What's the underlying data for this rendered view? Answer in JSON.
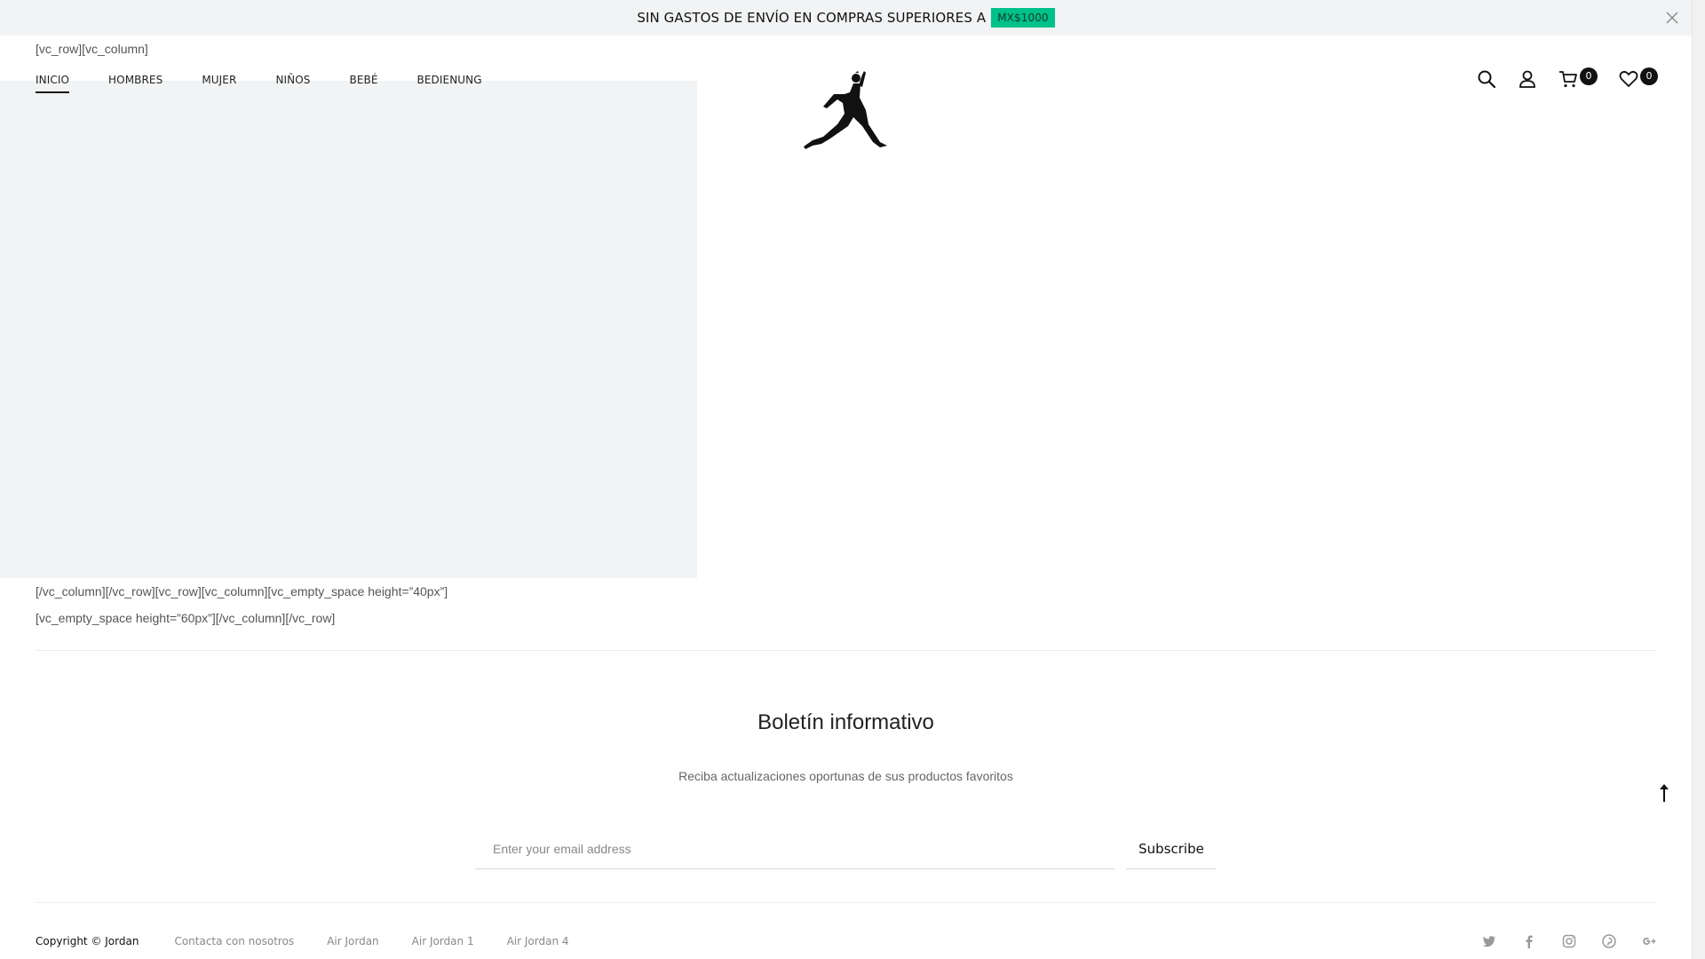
{
  "promo": {
    "text": "SIN GASTOS DE ENVÍO EN COMPRAS SUPERIORES A",
    "badge": "MX$1000",
    "badge_color": "#00c18a"
  },
  "shortcodes": {
    "top": "[vc_row][vc_column]",
    "line1": "[/vc_column][/vc_row][vc_row][vc_column][vc_empty_space height=”40px”]",
    "line2": "[vc_empty_space height=”60px”][/vc_column][/vc_row]"
  },
  "nav": {
    "items": [
      {
        "label": "INICIO"
      },
      {
        "label": "HOMBRES"
      },
      {
        "label": "MUJER"
      },
      {
        "label": "NIÑOS"
      },
      {
        "label": "BEBÉ"
      },
      {
        "label": "BEDIENUNG"
      }
    ]
  },
  "header": {
    "cart_count": "0",
    "wishlist_count": "0"
  },
  "newsletter": {
    "title": "Boletín informativo",
    "subtitle": "Reciba actualizaciones oportunas de sus productos favoritos",
    "placeholder": "Enter your email address",
    "button": "Subscribe"
  },
  "footer": {
    "copyright": "Copyright © Jordan",
    "links": [
      {
        "label": "Contacta con nosotros"
      },
      {
        "label": "Air Jordan"
      },
      {
        "label": "Air Jordan 1"
      },
      {
        "label": "Air Jordan 4"
      }
    ],
    "social_icons": [
      "twitter-icon",
      "facebook-icon",
      "instagram-icon",
      "pinterest-icon",
      "google-plus-icon"
    ]
  }
}
